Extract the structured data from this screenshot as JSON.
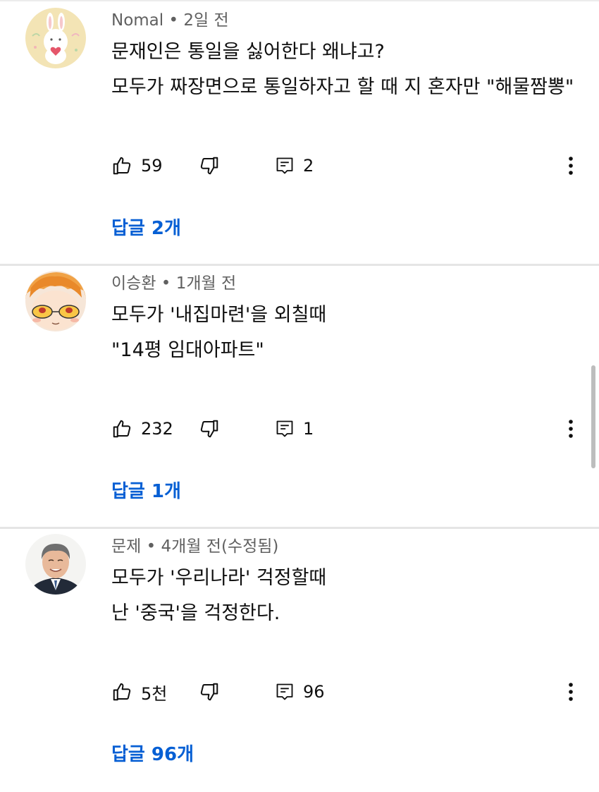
{
  "comments": [
    {
      "author": "Nomal",
      "time": "2일 전",
      "text": "문재인은 통일을 싫어한다 왜냐고?\n모두가 짜장면으로 통일하자고 할 때 지 혼자만 \"해물짬뽕\"",
      "likes": "59",
      "replies_count": "2",
      "replies_link": "답글 2개",
      "avatar_icon": "bunny-heart-avatar"
    },
    {
      "author": "이승환",
      "time": "1개월 전",
      "text": "모두가 '내집마련'을 외칠때\n\"14평 임대아파트\"",
      "likes": "232",
      "replies_count": "1",
      "replies_link": "답글 1개",
      "avatar_icon": "anime-character-avatar"
    },
    {
      "author": "문제",
      "time": "4개월 전(수정됨)",
      "text": "모두가 '우리나라' 걱정할때\n난 '중국'을 걱정한다.",
      "likes": "5천",
      "replies_count": "96",
      "replies_link": "답글 96개",
      "avatar_icon": "person-photo-avatar"
    }
  ],
  "separator": " • ",
  "colors": {
    "link": "#065fd4",
    "meta": "#606060",
    "text": "#0f0f0f",
    "divider": "#e5e5e5"
  }
}
